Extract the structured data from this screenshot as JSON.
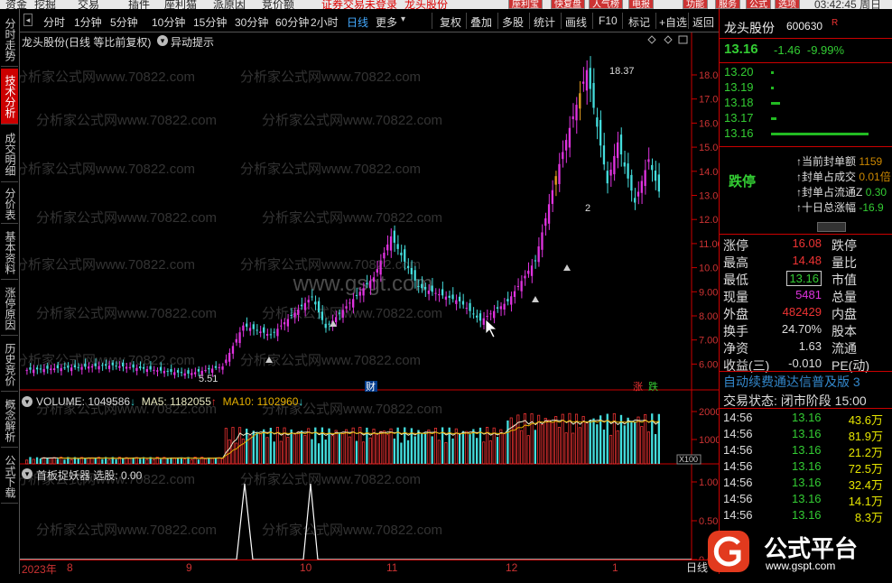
{
  "menubar": {
    "items": [
      "资金",
      "挖掘",
      "交易",
      "插件",
      "座利猫",
      "派原因",
      "竞价额",
      "证券交易未登录",
      "龙头股份"
    ],
    "badges": [
      "座利宝",
      "快复盘",
      "人气榜",
      "电报",
      "功能",
      "服务",
      "公式",
      "选项"
    ],
    "clock": "03:42:45 周日"
  },
  "left_tabs": [
    "分时走势",
    "技术分析",
    "成交明细",
    "分价表",
    "基本资料",
    "涨停原因",
    "历史竞价",
    "概念解析",
    "公式下载"
  ],
  "toolbar": {
    "periods": [
      "分时",
      "1分钟",
      "5分钟",
      "10分钟",
      "15分钟",
      "30分钟",
      "60分钟",
      "2小时",
      "日线",
      "更多"
    ],
    "selected": "日线",
    "tools": [
      "复权",
      "叠加",
      "多股",
      "统计",
      "画线",
      "F10",
      "标记",
      "+自选",
      "返回"
    ]
  },
  "chart_title": "龙头股份(日线 等比前复权)",
  "chart_hint": "异动提示",
  "hint_icon": "info-icon",
  "price_axis": [
    "18.00",
    "17.00",
    "16.00",
    "15.00",
    "14.00",
    "13.00",
    "12.00",
    "11.00",
    "10.00",
    "9.00",
    "8.00",
    "7.00",
    "6.00"
  ],
  "annotations": {
    "high": "18.37",
    "low": "5.51",
    "mid": "2",
    "cai": "财",
    "zhang": "涨",
    "die": "跌"
  },
  "volume": {
    "label": "VOLUME: 1049586",
    "ma5": "MA5: 1182055",
    "ma10": "MA10: 1102960",
    "axis": [
      "20000",
      "10000"
    ],
    "unit": "X100"
  },
  "indicator": {
    "label": "首板捉妖器  选股: 0.00",
    "axis": [
      "1.00",
      "0.50",
      "0.00"
    ]
  },
  "bottom_axis": [
    "2023年",
    "8",
    "9",
    "10",
    "11",
    "12",
    "1"
  ],
  "day_button": "日线",
  "watermark_text": "分析家公式网www.70822.com",
  "center_watermark": "www.gsgt.com",
  "logo": {
    "name": "公式平台",
    "url": "www.gspt.com"
  },
  "right": {
    "name": "龙头股份",
    "code": "600630",
    "r_mark": "R",
    "price": "13.16",
    "change": "-1.46",
    "pct": "-9.99%",
    "bids": [
      {
        "price": "13.20",
        "bar": 0.02
      },
      {
        "price": "13.19",
        "bar": 0.02
      },
      {
        "price": "13.18",
        "bar": 0.09
      },
      {
        "price": "13.17",
        "bar": 0.06
      },
      {
        "price": "13.16",
        "bar": 1.0
      }
    ],
    "limit_state": "跌停",
    "seal": [
      {
        "k": "当前封单额",
        "v": "1159"
      },
      {
        "k": "封单占成交",
        "v": "0.01倍"
      },
      {
        "k": "封单占流通Z",
        "v": "0.30"
      },
      {
        "k": "十日总涨幅",
        "v": "-16.9"
      }
    ],
    "stats": [
      {
        "k1": "涨停",
        "v1": "16.08",
        "c1": "red",
        "k2": "跌停"
      },
      {
        "k1": "最高",
        "v1": "14.48",
        "c1": "red",
        "k2": "量比"
      },
      {
        "k1": "最低",
        "v1": "13.16",
        "c1": "grn",
        "k2": "市值"
      },
      {
        "k1": "现量",
        "v1": "5481",
        "c1": "mag",
        "k2": "总量"
      },
      {
        "k1": "外盘",
        "v1": "482429",
        "c1": "red",
        "k2": "内盘"
      },
      {
        "k1": "换手",
        "v1": "24.70%",
        "c1": "wht",
        "k2": "股本"
      },
      {
        "k1": "净资",
        "v1": "1.63",
        "c1": "wht",
        "k2": "流通"
      },
      {
        "k1": "收益(三)",
        "v1": "-0.010",
        "c1": "wht",
        "k2": "PE(动)"
      }
    ],
    "subscribe": "自动续费通达信普及版  3",
    "trade_status": "交易状态: 闭市阶段  15:00",
    "ticks": [
      {
        "t": "14:56",
        "p": "13.16",
        "v": "43.6万"
      },
      {
        "t": "14:56",
        "p": "13.16",
        "v": "81.9万"
      },
      {
        "t": "14:56",
        "p": "13.16",
        "v": "21.2万"
      },
      {
        "t": "14:56",
        "p": "13.16",
        "v": "72.5万"
      },
      {
        "t": "14:56",
        "p": "13.16",
        "v": "32.4万"
      },
      {
        "t": "14:56",
        "p": "13.16",
        "v": "14.1万"
      },
      {
        "t": "14:56",
        "p": "13.16",
        "v": "8.3万"
      }
    ]
  }
}
